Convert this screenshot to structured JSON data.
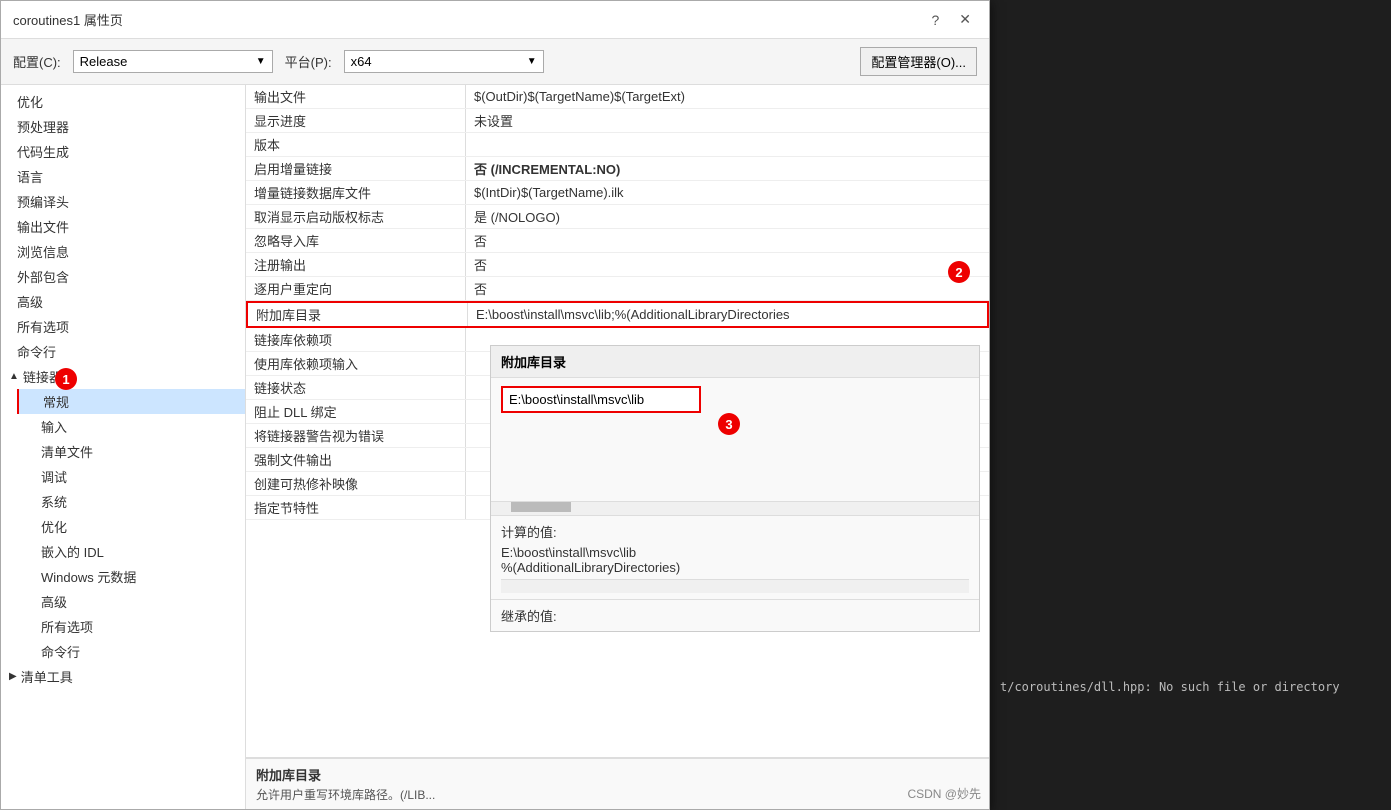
{
  "window": {
    "title": "coroutines1 属性页",
    "help_btn": "?",
    "close_btn": "✕"
  },
  "config": {
    "label_config": "配置(C):",
    "config_value": "Release",
    "label_platform": "平台(P):",
    "platform_value": "x64",
    "manager_btn": "配置管理器(O)..."
  },
  "sidebar": {
    "items": [
      {
        "label": "优化",
        "indent": 1
      },
      {
        "label": "预处理器",
        "indent": 1
      },
      {
        "label": "代码生成",
        "indent": 1
      },
      {
        "label": "语言",
        "indent": 1
      },
      {
        "label": "预编译头",
        "indent": 1
      },
      {
        "label": "输出文件",
        "indent": 1
      },
      {
        "label": "浏览信息",
        "indent": 1
      },
      {
        "label": "外部包含",
        "indent": 1
      },
      {
        "label": "高级",
        "indent": 1
      },
      {
        "label": "所有选项",
        "indent": 1
      },
      {
        "label": "命令行",
        "indent": 1
      },
      {
        "label": "▲ 链接器",
        "indent": 0,
        "section": true,
        "expanded": true
      },
      {
        "label": "常规",
        "indent": 2,
        "selected": true
      },
      {
        "label": "输入",
        "indent": 2
      },
      {
        "label": "清单文件",
        "indent": 2
      },
      {
        "label": "调试",
        "indent": 2
      },
      {
        "label": "系统",
        "indent": 2
      },
      {
        "label": "优化",
        "indent": 2
      },
      {
        "label": "嵌入的 IDL",
        "indent": 2
      },
      {
        "label": "Windows 元数据",
        "indent": 2
      },
      {
        "label": "高级",
        "indent": 2
      },
      {
        "label": "所有选项",
        "indent": 2
      },
      {
        "label": "命令行",
        "indent": 2
      },
      {
        "label": "▶ 清单工具",
        "indent": 0,
        "section": true,
        "expanded": false
      }
    ]
  },
  "properties": {
    "rows": [
      {
        "name": "输出文件",
        "value": "$(OutDir)$(TargetName)$(TargetExt)"
      },
      {
        "name": "显示进度",
        "value": "未设置"
      },
      {
        "name": "版本",
        "value": ""
      },
      {
        "name": "启用增量链接",
        "value": "否 (/INCREMENTAL:NO)",
        "bold": true
      },
      {
        "name": "增量链接数据库文件",
        "value": "$(IntDir)$(TargetName).ilk"
      },
      {
        "name": "取消显示启动版权标志",
        "value": "是 (/NOLOGO)"
      },
      {
        "name": "忽略导入库",
        "value": "否"
      },
      {
        "name": "注册输出",
        "value": "否"
      },
      {
        "name": "逐用户重定向",
        "value": "否"
      },
      {
        "name": "附加库目录",
        "value": "E:\\boost\\install\\msvc\\lib;%(AdditionalLibraryDirectories",
        "highlighted": true
      },
      {
        "name": "链接库依赖项",
        "value": ""
      },
      {
        "name": "使用库依赖项输入",
        "value": ""
      },
      {
        "name": "链接状态",
        "value": ""
      },
      {
        "name": "阻止 DLL 绑定",
        "value": ""
      },
      {
        "name": "将链接器警告视为错误",
        "value": ""
      },
      {
        "name": "强制文件输出",
        "value": ""
      },
      {
        "name": "创建可热修补映像",
        "value": ""
      },
      {
        "name": "指定节特性",
        "value": ""
      }
    ]
  },
  "desc_panel": {
    "title": "附加库目录",
    "text": "允许用户重写环境库路径。(/LIB..."
  },
  "tooltip": {
    "title": "附加库目录",
    "input_value": "E:\\boost\\install\\msvc\\lib",
    "calc_title": "计算的值:",
    "calc_line1": "E:\\boost\\install\\msvc\\lib",
    "calc_line2": "%(AdditionalLibraryDirectories)",
    "inherit_title": "继承的值:"
  },
  "badges": {
    "badge1": "1",
    "badge2": "2",
    "badge3": "3"
  },
  "bg_editor_text": "t/coroutines/dll.hpp: No such file or directory",
  "watermark": "CSDN @妙先"
}
